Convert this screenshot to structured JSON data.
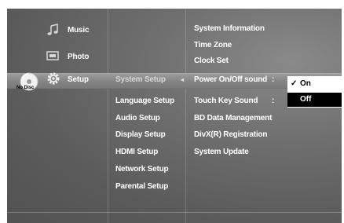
{
  "main_menu": {
    "items": [
      {
        "label": "Music",
        "icon": "music-note-icon"
      },
      {
        "label": "Photo",
        "icon": "photo-icon"
      },
      {
        "label": "Setup",
        "icon": "gear-icon"
      }
    ]
  },
  "disc_status": {
    "label": "No Disc",
    "icon": "disc-icon"
  },
  "setup_menu": {
    "items": [
      "System Setup",
      "Language Setup",
      "Audio Setup",
      "Display Setup",
      "HDMI Setup",
      "Network Setup",
      "Parental Setup"
    ]
  },
  "system_setup": {
    "items": [
      "System Information",
      "Time Zone",
      "Clock Set",
      "Power On/Off sound",
      "Touch Key Sound",
      "BD Data Management",
      "DivX(R) Registration",
      "System Update"
    ],
    "colon": ":"
  },
  "option_popup": {
    "options": [
      "On",
      "Off"
    ],
    "selected_index": 0,
    "check_mark": "✓"
  },
  "colors": {
    "background": "#666666",
    "highlight": "#8a8a8a",
    "popup_selected_bg": "#ffffff",
    "popup_unselected_bg": "#000000"
  }
}
